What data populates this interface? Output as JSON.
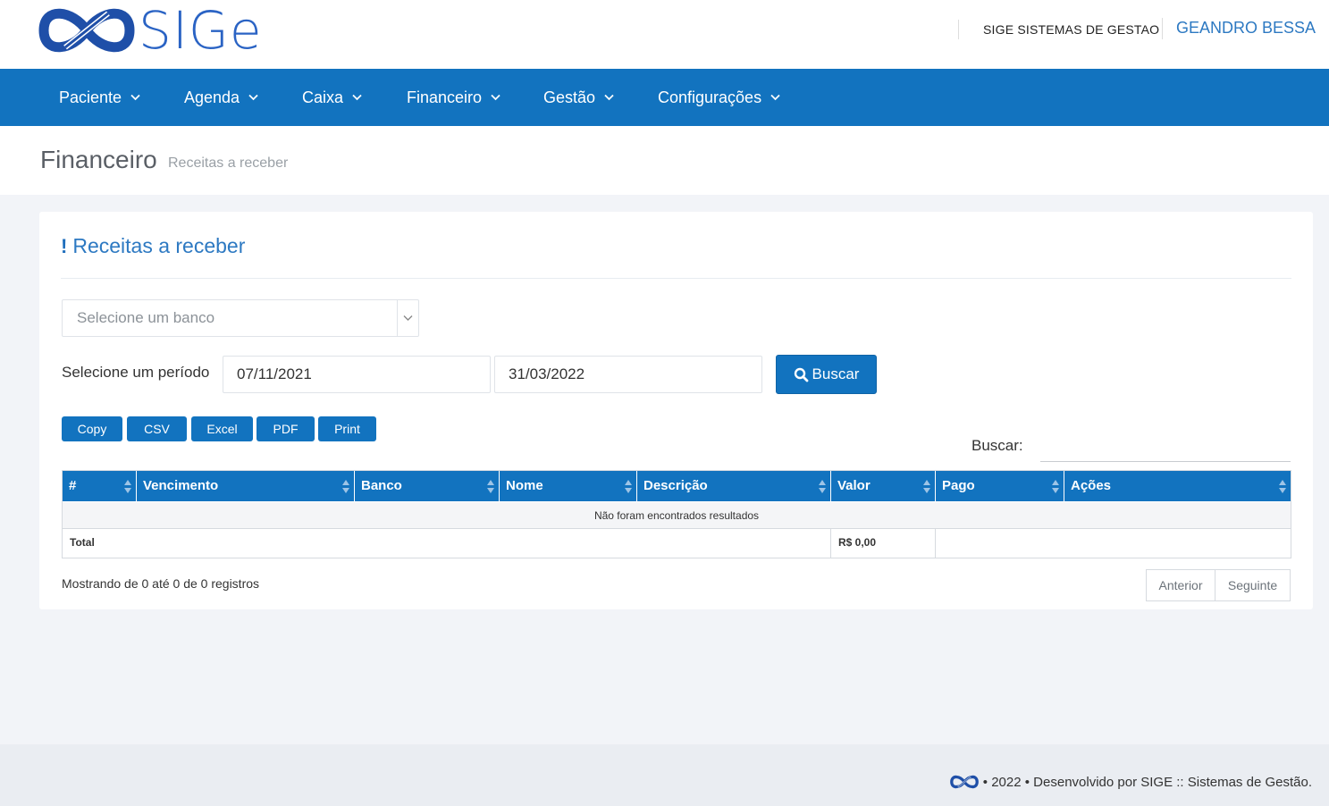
{
  "header": {
    "logo_text": "SIGe",
    "company": "SIGE SISTEMAS DE GESTAO",
    "user": "GEANDRO BESSA",
    "brand_color": "#1273bf"
  },
  "nav": {
    "items": [
      {
        "label": "Paciente"
      },
      {
        "label": "Agenda"
      },
      {
        "label": "Caixa"
      },
      {
        "label": "Financeiro"
      },
      {
        "label": "Gestão"
      },
      {
        "label": "Configurações"
      }
    ]
  },
  "page": {
    "title": "Financeiro",
    "subtitle": "Receitas a receber"
  },
  "card": {
    "title": "Receitas a receber",
    "title_icon": "exclamation-icon",
    "bank_select_placeholder": "Selecione um banco",
    "period_label": "Selecione um período",
    "date_start": "07/11/2021",
    "date_end": "31/03/2022",
    "search_button": "Buscar",
    "export_buttons": [
      "Copy",
      "CSV",
      "Excel",
      "PDF",
      "Print"
    ],
    "search_label": "Buscar:",
    "search_value": ""
  },
  "table": {
    "columns": [
      "#",
      "Vencimento",
      "Banco",
      "Nome",
      "Descrição",
      "Valor",
      "Pago",
      "Ações"
    ],
    "empty_message": "Não foram encontrados resultados",
    "total_label": "Total",
    "total_value": "R$ 0,00"
  },
  "pagination": {
    "info": "Mostrando de 0 até 0 de 0 registros",
    "prev": "Anterior",
    "next": "Seguinte"
  },
  "footer": {
    "text": "• 2022 • Desenvolvido por SIGE :: Sistemas de Gestão."
  }
}
